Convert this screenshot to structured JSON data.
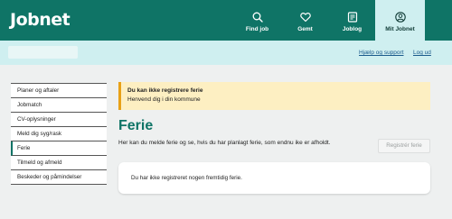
{
  "brand": {
    "logo_text": "Jobnet"
  },
  "nav": [
    {
      "label": "Find job",
      "icon": "search-icon"
    },
    {
      "label": "Gemt",
      "icon": "heart-icon"
    },
    {
      "label": "Joblog",
      "icon": "joblog-icon"
    },
    {
      "label": "Mit Jobnet",
      "icon": "user-icon",
      "active": true
    }
  ],
  "subnav": {
    "help_label": "Hjælp og support",
    "logout_label": "Log ud"
  },
  "sidemenu": {
    "items": [
      {
        "label": "Planer og aftaler"
      },
      {
        "label": "Jobmatch"
      },
      {
        "label": "CV-oplysninger"
      },
      {
        "label": "Meld dig syg/rask"
      },
      {
        "label": "Ferie",
        "current": true
      },
      {
        "label": "Tilmeld og afmeld"
      },
      {
        "label": "Beskeder og påmindelser"
      }
    ]
  },
  "alert": {
    "title": "Du kan ikke registrere ferie",
    "text": "Henvend dig i din kommune"
  },
  "main": {
    "title": "Ferie",
    "intro": "Her kan du melde ferie og se, hvis du har planlagt ferie, som endnu ike er afholdt.",
    "register_button": "Registrér ferie",
    "empty_text": "Du har ikke registreret nogen fremtidig ferie."
  },
  "colors": {
    "brand": "#0f7466",
    "subbar": "#cfeff0",
    "alert_bg": "#fdefc2",
    "alert_border": "#e8a117"
  }
}
